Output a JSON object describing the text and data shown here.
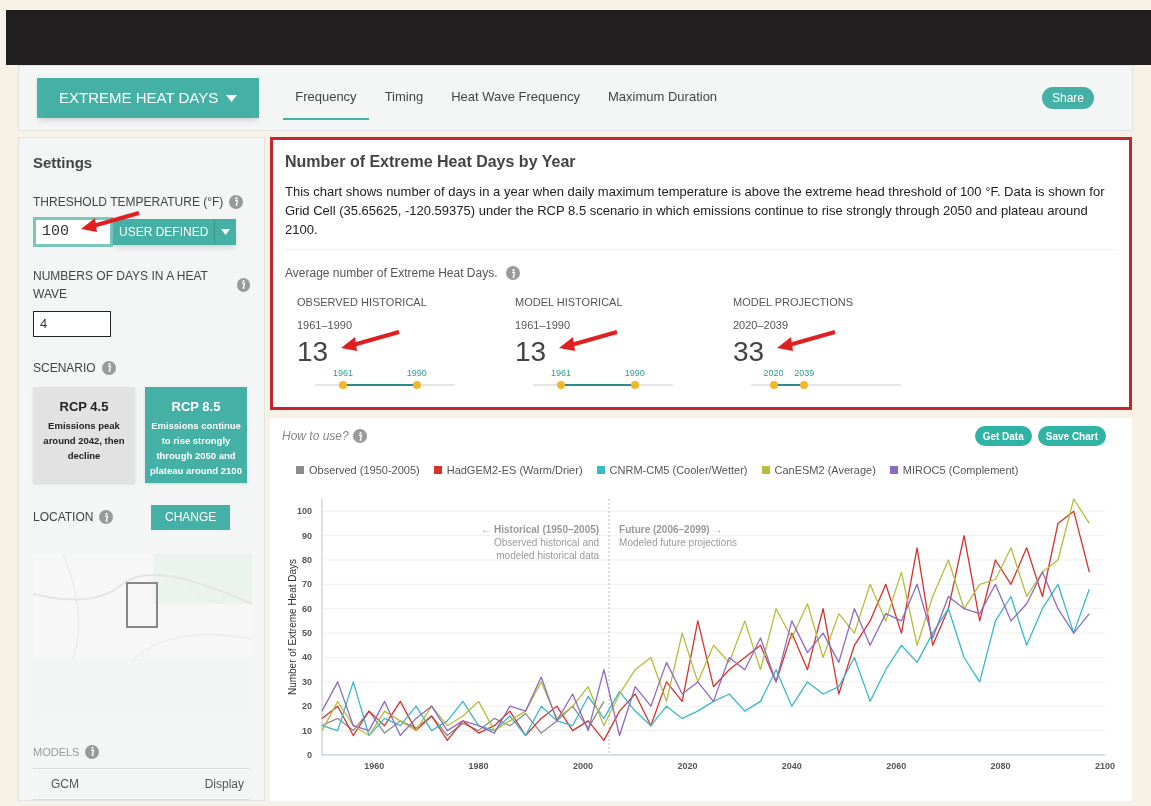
{
  "nav": {
    "dropdown": "EXTREME HEAT DAYS",
    "tabs": [
      {
        "label": "Frequency",
        "selected": true
      },
      {
        "label": "Timing",
        "selected": false
      },
      {
        "label": "Heat Wave Frequency",
        "selected": false
      },
      {
        "label": "Maximum Duration",
        "selected": false
      }
    ],
    "share": "Share"
  },
  "settings": {
    "title": "Settings",
    "threshold_label": "THRESHOLD TEMPERATURE (°F)",
    "threshold_value": "100",
    "threshold_mode": "USER DEFINED",
    "days_label": "NUMBERS OF DAYS IN A HEAT WAVE",
    "days_value": "4",
    "scenario_label": "SCENARIO",
    "scenarios": [
      {
        "title": "RCP 4.5",
        "description": "Emissions peak around 2042, then decline",
        "selected": false
      },
      {
        "title": "RCP 8.5",
        "description": "Emissions continue to rise strongly through 2050 and plateau around 2100",
        "selected": true
      }
    ],
    "location_label": "LOCATION",
    "change": "CHANGE",
    "map": {
      "kind": "picture"
    },
    "models_label": "MODELS",
    "models_columns": [
      "GCM",
      "Display"
    ]
  },
  "summary": {
    "title": "Number of Extreme Heat Days by Year",
    "description": "This chart shows number of days in a year when daily maximum temperature is above the extreme head threshold of 100 °F. Data is shown for Grid Cell (35.65625, -120.59375) under the RCP 8.5 scenario in which emissions continue to rise strongly through 2050 and plateau around 2100.",
    "average_label": "Average number of Extreme Heat Days.",
    "stats": [
      {
        "kind": "historical",
        "label": "OBSERVED HISTORICAL",
        "period": "1961–1990",
        "value": "13",
        "start": "1961",
        "end": "1990"
      },
      {
        "kind": "historical",
        "label": "MODEL HISTORICAL",
        "period": "1961–1990",
        "value": "13",
        "start": "1961",
        "end": "1990"
      },
      {
        "kind": "projection",
        "label": "MODEL PROJECTIONS",
        "period": "2020–2039",
        "value": "33",
        "start": "2020",
        "end": "2039"
      }
    ]
  },
  "chart": {
    "help": "How to use?",
    "buttons": [
      "Get Data",
      "Save Chart"
    ],
    "chart_data": {
      "type": "line",
      "ylabel": "Number of Extreme Heat Days",
      "xlim": [
        1950,
        2100
      ],
      "ylim": [
        0,
        105
      ],
      "xticks": [
        1960,
        1980,
        2000,
        2020,
        2040,
        2060,
        2080,
        2100
      ],
      "yticks": [
        0,
        10,
        20,
        30,
        40,
        50,
        60,
        70,
        80,
        90,
        100
      ],
      "grid": true,
      "ref_lines": [
        {
          "axis": "x",
          "value": 2005
        }
      ],
      "annotations": [
        "← Historical (1950–2005)",
        "Observed historical and",
        "modeled historical data",
        "Future (2006–2099) →",
        "Modeled future projections"
      ],
      "x": [
        1950,
        1953,
        1956,
        1959,
        1962,
        1965,
        1968,
        1971,
        1974,
        1977,
        1980,
        1983,
        1986,
        1989,
        1992,
        1995,
        1998,
        2001,
        2004,
        2007,
        2010,
        2013,
        2016,
        2019,
        2022,
        2025,
        2028,
        2031,
        2034,
        2037,
        2040,
        2043,
        2046,
        2049,
        2052,
        2055,
        2058,
        2061,
        2064,
        2067,
        2070,
        2073,
        2076,
        2079,
        2082,
        2085,
        2088,
        2091,
        2094,
        2097
      ],
      "series": [
        {
          "name": "Observed (1950-2005)",
          "color": "#8c8c8c",
          "values": [
            12,
            15,
            10,
            18,
            9,
            14,
            11,
            16,
            8,
            13,
            10,
            15,
            12,
            17,
            9,
            14,
            20,
            11,
            22,
            null,
            null,
            null,
            null,
            null,
            null,
            null,
            null,
            null,
            null,
            null,
            null,
            null,
            null,
            null,
            null,
            null,
            null,
            null,
            null,
            null,
            null,
            null,
            null,
            null,
            null,
            null,
            null,
            null,
            null,
            null
          ]
        },
        {
          "name": "HadGEM2-ES (Warm/Drier)",
          "color": "#d7312d",
          "values": [
            15,
            20,
            8,
            18,
            12,
            22,
            10,
            16,
            6,
            14,
            9,
            12,
            18,
            8,
            15,
            20,
            10,
            14,
            6,
            18,
            25,
            12,
            30,
            22,
            55,
            28,
            35,
            40,
            45,
            30,
            50,
            35,
            60,
            25,
            45,
            55,
            70,
            50,
            85,
            45,
            60,
            90,
            55,
            80,
            70,
            85,
            65,
            95,
            100,
            75
          ]
        },
        {
          "name": "CNRM-CM5 (Cooler/Wetter)",
          "color": "#36b9cc",
          "values": [
            12,
            10,
            30,
            8,
            15,
            12,
            20,
            10,
            14,
            22,
            12,
            10,
            16,
            8,
            20,
            14,
            12,
            24,
            15,
            26,
            18,
            12,
            20,
            15,
            18,
            22,
            25,
            18,
            22,
            35,
            20,
            30,
            25,
            28,
            40,
            22,
            35,
            45,
            38,
            50,
            60,
            40,
            30,
            55,
            65,
            45,
            60,
            70,
            50,
            68
          ]
        },
        {
          "name": "CanESM2 (Average)",
          "color": "#b5bd3a",
          "values": [
            10,
            22,
            12,
            8,
            18,
            14,
            10,
            20,
            12,
            16,
            22,
            10,
            14,
            18,
            30,
            15,
            20,
            28,
            12,
            25,
            35,
            40,
            22,
            50,
            30,
            45,
            38,
            55,
            35,
            60,
            48,
            62,
            40,
            58,
            50,
            70,
            55,
            75,
            45,
            65,
            80,
            60,
            70,
            72,
            85,
            65,
            75,
            80,
            105,
            95
          ]
        },
        {
          "name": "MIROC5 (Complement)",
          "color": "#8e6bbf",
          "values": [
            18,
            30,
            12,
            10,
            22,
            8,
            15,
            20,
            10,
            14,
            12,
            9,
            20,
            18,
            32,
            14,
            25,
            10,
            35,
            8,
            28,
            20,
            38,
            25,
            30,
            22,
            40,
            35,
            48,
            30,
            55,
            42,
            50,
            38,
            60,
            45,
            58,
            55,
            70,
            48,
            65,
            60,
            58,
            70,
            55,
            62,
            75,
            60,
            50,
            58
          ]
        }
      ]
    }
  }
}
